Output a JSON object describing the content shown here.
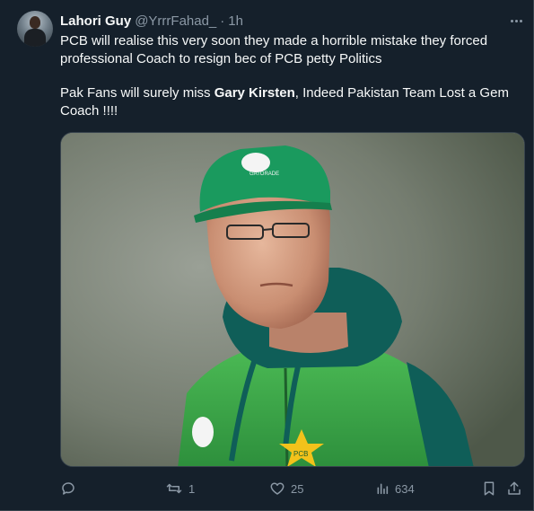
{
  "tweet": {
    "author_name": "Lahori Guy",
    "author_handle": "@YrrrFahad_",
    "separator": "·",
    "time": "1h",
    "line1": "PCB will realise this very soon they made a horrible mistake they forced professional Coach to resign bec of PCB petty Politics",
    "line2_before": "Pak Fans will surely miss ",
    "line2_bold": "Gary Kirsten",
    "line2_after": ", Indeed Pakistan Team Lost a Gem Coach !!!!",
    "cap_logo_text": "GATORADE",
    "shirt_emblem_text": "PCB"
  },
  "actions": {
    "reply_count": "",
    "retweet_count": "1",
    "like_count": "25",
    "views_count": "634"
  },
  "colors": {
    "background": "#15202b",
    "text": "#f7f9f9",
    "secondary": "#8b98a5",
    "border": "#38444d",
    "jersey_green": "#3aa64a",
    "jersey_teal": "#0f5e58"
  },
  "icons": [
    "more-icon",
    "reply-icon",
    "retweet-icon",
    "like-icon",
    "views-icon",
    "bookmark-icon",
    "share-icon"
  ]
}
